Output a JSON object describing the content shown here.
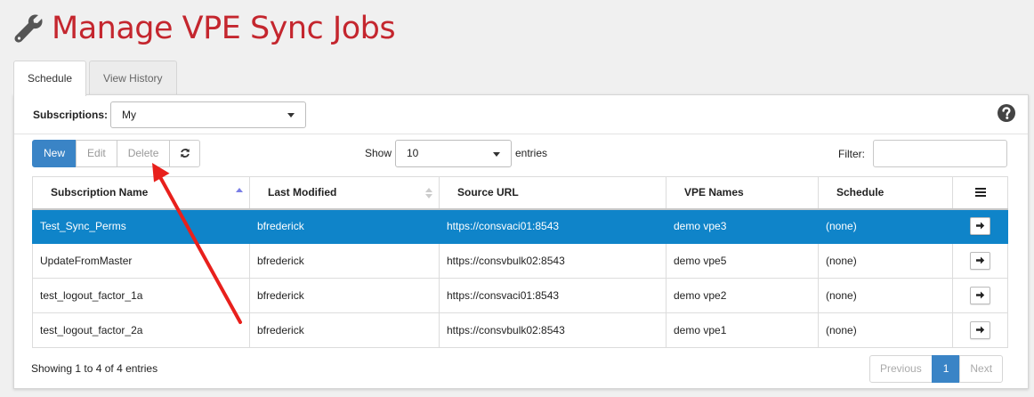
{
  "header": {
    "title": "Manage VPE Sync Jobs",
    "icon": "wrench-icon",
    "title_color": "#c4262e"
  },
  "tabs": [
    {
      "label": "Schedule",
      "active": true
    },
    {
      "label": "View History",
      "active": false
    }
  ],
  "subscriptions": {
    "label": "Subscriptions:",
    "value": "My"
  },
  "toolbar": {
    "new_label": "New",
    "edit_label": "Edit",
    "delete_label": "Delete",
    "refresh_icon": "refresh-icon"
  },
  "length": {
    "show_label": "Show",
    "value": "10",
    "entries_label": "entries"
  },
  "filter": {
    "label": "Filter:",
    "value": ""
  },
  "table": {
    "headers": [
      "Subscription Name",
      "Last Modified",
      "Source URL",
      "VPE Names",
      "Schedule"
    ],
    "rows": [
      {
        "name": "Test_Sync_Perms",
        "modified": "bfrederick",
        "url": "https://consvaci01:8543",
        "vpe": "demo vpe3",
        "schedule": "(none)",
        "selected": true
      },
      {
        "name": "UpdateFromMaster",
        "modified": "bfrederick",
        "url": "https://consvbulk02:8543",
        "vpe": "demo vpe5",
        "schedule": "(none)",
        "selected": false
      },
      {
        "name": "test_logout_factor_1a",
        "modified": "bfrederick",
        "url": "https://consvaci01:8543",
        "vpe": "demo vpe2",
        "schedule": "(none)",
        "selected": false
      },
      {
        "name": "test_logout_factor_2a",
        "modified": "bfrederick",
        "url": "https://consvbulk02:8543",
        "vpe": "demo vpe1",
        "schedule": "(none)",
        "selected": false
      }
    ]
  },
  "footer": {
    "info": "Showing 1 to 4 of 4 entries"
  },
  "pagination": {
    "previous": "Previous",
    "page": "1",
    "next": "Next"
  },
  "colors": {
    "primary": "#3a84c6",
    "selected_row": "#0f84c9",
    "annotation_arrow": "#e8201c"
  }
}
